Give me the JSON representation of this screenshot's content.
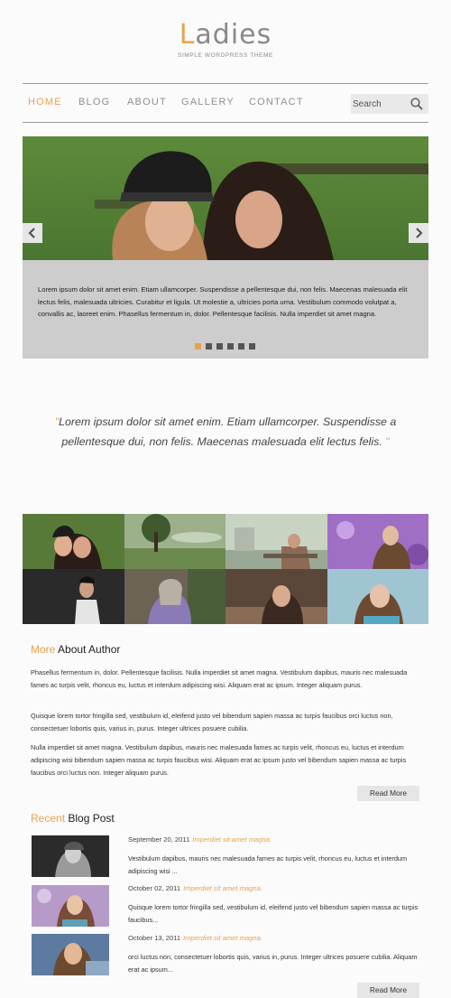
{
  "header": {
    "logo_accent": "L",
    "logo_rest": "adies",
    "tagline": "SIMPLE WORDPRESS THEME"
  },
  "nav": {
    "items": [
      {
        "label": "HOME",
        "active": true
      },
      {
        "label": "BLOG",
        "active": false
      },
      {
        "label": "ABOUT",
        "active": false
      },
      {
        "label": "GALLERY",
        "active": false
      },
      {
        "label": "CONTACT",
        "active": false
      }
    ],
    "search_placeholder": "Search",
    "search_icon": "magnifier-icon"
  },
  "slider": {
    "caption": "Lorem ipsum dolor sit amet enim. Etiam ullamcorper. Suspendisse a pellentesque dui, non felis. Maecenas malesuada elit lectus felis, malesuada ultricies. Curabitur et ligula. Ut molestie a, ultricies porta urna. Vestibulum commodo volutpat a, convallis ac, laoreet enim. Phasellus fermentum in, dolor. Pellentesque facilisis. Nulla imperdiet sit amet magna.",
    "dots_total": 6,
    "active_dot": 1,
    "prev_icon": "chevron-left-icon",
    "next_icon": "chevron-right-icon"
  },
  "quote": {
    "open": "\"",
    "text": "Lorem ipsum dolor sit amet enim. Etiam ullamcorper. Suspendisse a pellentesque dui, non felis. Maecenas malesuada elit lectus felis.",
    "close": " \""
  },
  "about": {
    "title_accent": "More",
    "title_rest": " About Author",
    "paragraphs": [
      "Phasellus fermentum in, dolor. Pellentesque facilisis. Nulla imperdiet sit amet magna. Vestibulum dapibus, mauris nec malesuada fames ac turpis velit, rhoncus eu, luctus et interdum adipiscing wisi. Aliquam erat ac ipsum. Integer aliquam purus.",
      "Quisque lorem tortor fringilla sed, vestibulum id, eleifend justo vel bibendum sapien massa ac turpis faucibus orci luctus non, consectetuer lobortis quis, varius in, purus. Integer ultrices posuere cubilia.",
      "Nulla imperdiet sit amet magna. Vestibulum dapibus, mauris nec malesuada fames ac turpis velit, rhoncus eu, luctus et interdum adipiscing wisi bibendum sapien massa ac turpis faucibus wisi. Aliquam erat ac ipsum justo vel bibendum sapien massa ac turpis faucibus orci luctus non. Integer aliquam purus."
    ],
    "read_more": "Read More"
  },
  "blog": {
    "title_accent": "Recent",
    "title_rest": " Blog Post",
    "posts": [
      {
        "date": "September 20, 2011",
        "title": "Imperdiet sit amet magna.",
        "excerpt": "Vestibulum dapibus, mauris nec malesuada fames ac turpis velit, rhoncus eu, luctus et interdum adipiscing wisi ..."
      },
      {
        "date": "October 02, 2011",
        "title": "Imperdiet sit amet magna.",
        "excerpt": "Quisque lorem tortor fringilla sed, vestibulum id, eleifend justo vel bibendum sapien massa ac turpis faucibus..."
      },
      {
        "date": "October 13, 2011",
        "title": "Imperdiet sit amet magna.",
        "excerpt": "orci luctus non, consectetuer lobortis quis, varius in, purus. Integer ultrices posuere cubilia. Aliquam erat ac ipsum..."
      }
    ],
    "read_more": "Read More"
  },
  "colors": {
    "accent": "#e8a14d",
    "caption_bg": "#cdcdcd",
    "nav_text": "#8f8f8f"
  }
}
